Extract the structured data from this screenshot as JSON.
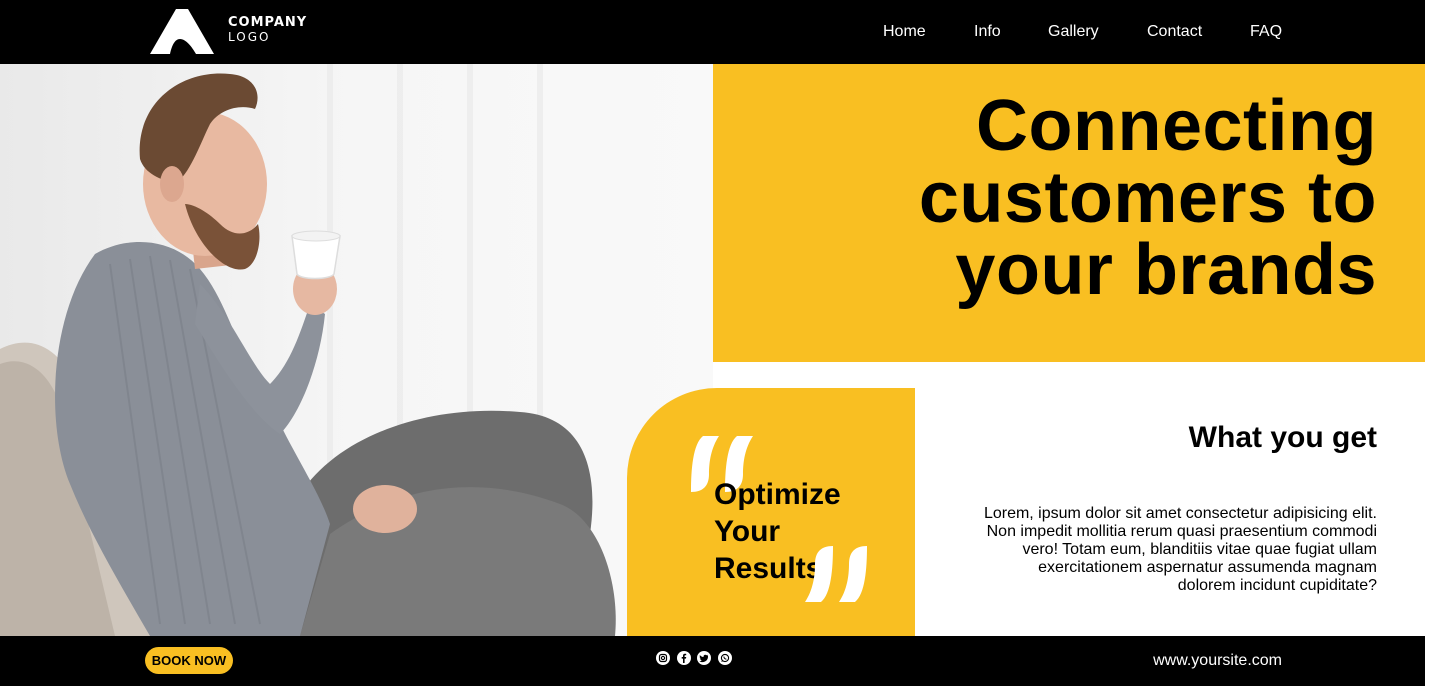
{
  "brand": {
    "line1": "COMPANY",
    "line2": "LOGO"
  },
  "nav": [
    {
      "label": "Home"
    },
    {
      "label": "Info"
    },
    {
      "label": "Gallery"
    },
    {
      "label": "Contact"
    },
    {
      "label": "FAQ"
    }
  ],
  "hero": {
    "line1": "Connecting",
    "line2": "customers to",
    "line3": "your brands"
  },
  "quote": {
    "line1": "Optimize",
    "line2": "Your",
    "line3": "Results"
  },
  "what_you_get": {
    "title": "What you get",
    "body": "Lorem, ipsum dolor sit amet consectetur adipisicing elit. Non impedit mollitia rerum quasi praesentium commodi vero! Totam eum, blanditiis vitae quae fugiat ullam exercitationem aspernatur assumenda magnam dolorem incidunt cupiditate?"
  },
  "footer": {
    "button": "BOOK NOW",
    "site": "www.yoursite.com",
    "social_icons": [
      "instagram-icon",
      "facebook-icon",
      "twitter-icon",
      "whatsapp-icon"
    ]
  },
  "colors": {
    "accent": "#f9bf22",
    "dark": "#000000",
    "light": "#ffffff"
  }
}
